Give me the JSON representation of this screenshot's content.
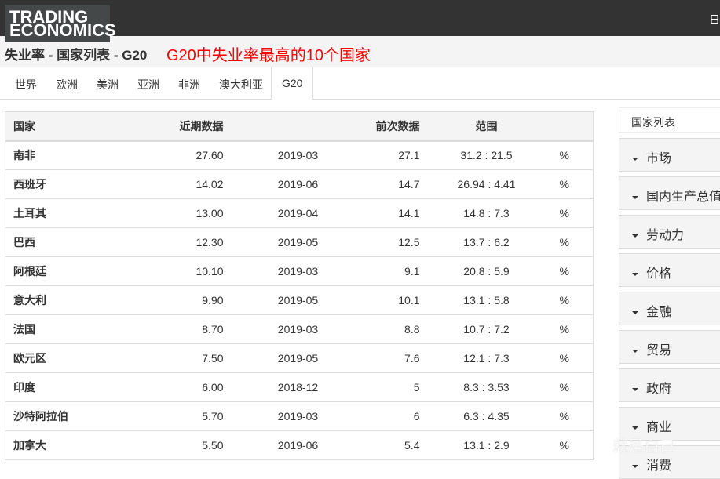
{
  "header": {
    "logo": [
      "TRADING",
      "ECONOMICS"
    ],
    "right_text": "日"
  },
  "title": "失业率 - 国家列表 - G20",
  "annotation": "G20中失业率最高的10个国家",
  "tabs": [
    "世界",
    "欧洲",
    "美洲",
    "亚洲",
    "非洲",
    "澳大利亚",
    "G20"
  ],
  "table": {
    "headers": [
      "国家",
      "近期数据",
      "",
      "前次数据",
      "范围",
      ""
    ],
    "rows": [
      [
        "南非",
        "27.60",
        "2019-03",
        "27.1",
        "31.2 : 21.5",
        "%"
      ],
      [
        "西班牙",
        "14.02",
        "2019-06",
        "14.7",
        "26.94 : 4.41",
        "%"
      ],
      [
        "土耳其",
        "13.00",
        "2019-04",
        "14.1",
        "14.8 : 7.3",
        "%"
      ],
      [
        "巴西",
        "12.30",
        "2019-05",
        "12.5",
        "13.7 : 6.2",
        "%"
      ],
      [
        "阿根廷",
        "10.10",
        "2019-03",
        "9.1",
        "20.8 : 5.9",
        "%"
      ],
      [
        "意大利",
        "9.90",
        "2019-05",
        "10.1",
        "13.1 : 5.8",
        "%"
      ],
      [
        "法国",
        "8.70",
        "2019-03",
        "8.8",
        "10.7 : 7.2",
        "%"
      ],
      [
        "欧元区",
        "7.50",
        "2019-05",
        "7.6",
        "12.1 : 7.3",
        "%"
      ],
      [
        "印度",
        "6.00",
        "2018-12",
        "5",
        "8.3 : 3.53",
        "%"
      ],
      [
        "沙特阿拉伯",
        "5.70",
        "2019-03",
        "6",
        "6.3 : 4.35",
        "%"
      ],
      [
        "加拿大",
        "5.50",
        "2019-06",
        "5.4",
        "13.1 : 2.9",
        "%"
      ]
    ]
  },
  "sidebar": {
    "header": "国家列表",
    "items": [
      "市场",
      "国内生产总值",
      "劳动力",
      "价格",
      "金融",
      "贸易",
      "政府",
      "商业",
      "消费"
    ]
  },
  "watermark": "就是自己"
}
